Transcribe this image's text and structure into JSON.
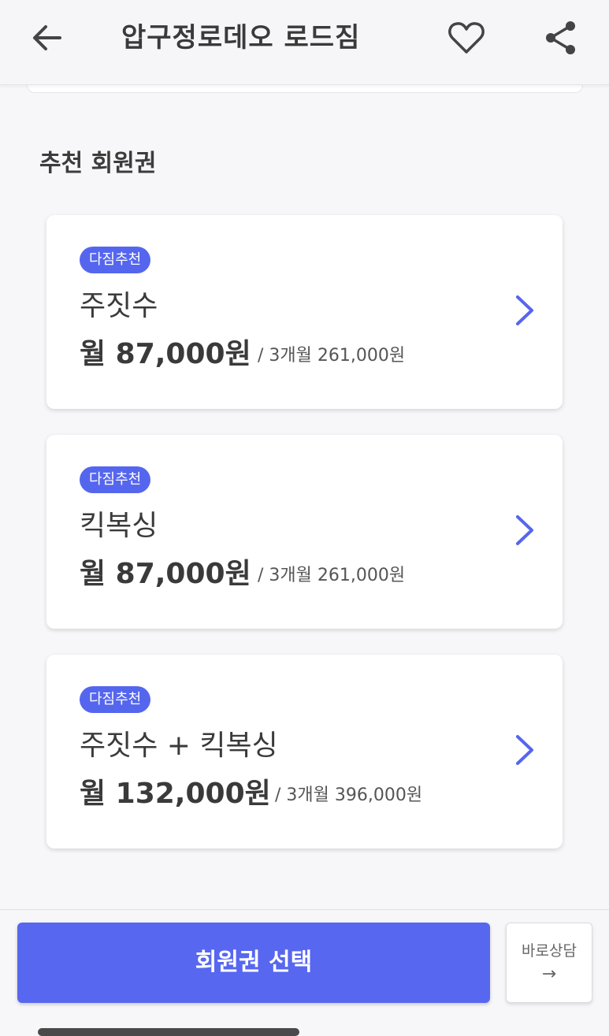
{
  "header": {
    "title": "압구정로데오 로드짐",
    "icons": {
      "back": "arrow-left-icon",
      "favorite": "heart-icon",
      "share": "share-icon"
    }
  },
  "section": {
    "title": "추천 회원권"
  },
  "plans": [
    {
      "badge": "다짐추천",
      "name": "주짓수",
      "price": "월 87,000원",
      "sub": "/ 3개월 261,000원"
    },
    {
      "badge": "다짐추천",
      "name": "킥복싱",
      "price": "월 87,000원",
      "sub": "/ 3개월 261,000원"
    },
    {
      "badge": "다짐추천",
      "name": "주짓수 + 킥복싱",
      "price": "월 132,000원",
      "sub": "/ 3개월 396,000원"
    }
  ],
  "bottom_bar": {
    "primary_label": "회원권 선택",
    "consult_label": "바로상담",
    "consult_arrow": "→"
  },
  "colors": {
    "accent": "#5767f0",
    "badge": "#5566ee",
    "chevron": "#5566ee"
  }
}
